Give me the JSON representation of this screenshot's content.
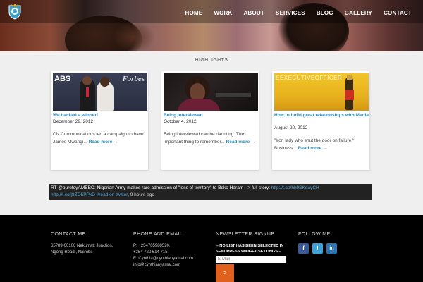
{
  "nav": {
    "items": [
      "HOME",
      "WORK",
      "ABOUT",
      "SERVICES",
      "BLOG",
      "GALLERY",
      "CONTACT"
    ]
  },
  "highlights": {
    "title": "HIGHLIGHTS",
    "cards": [
      {
        "title": "We backed a winner!",
        "date": "December 29, 2012",
        "excerpt": "  CN Communications led a campaign to have James Mwangi...",
        "more": "Read more →",
        "image_text_left": "ABS",
        "image_text_right": "Forbes"
      },
      {
        "title": "Being Interviewed",
        "date": "October 4, 2012",
        "excerpt": "Being interviewed can be daunting. The important thing to remember...",
        "more": "Read more →"
      },
      {
        "title": "How to build great relationships with Media",
        "date": "August 20, 2012",
        "excerpt": "\"Iron lady who shut the door on failure  \" Business...",
        "more": "Read more →",
        "image_text": "EEXECUTIVEOFFICER"
      }
    ]
  },
  "twitter": {
    "text": "RT @purefoyAMEBO: Nigerian Army makes rare admission of \"loss of territory\" to Boko Haram --> full story: ",
    "link1": "http://t.co/hh9SKdayCH",
    "link2": "http://t.co/j8ZO5PPxD",
    "link3": "#read on twitter",
    "time": ", 9 hours ago"
  },
  "footer": {
    "contact": {
      "heading": "CONTACT ME",
      "line1": "65789-00100 Nakumatt Junction,",
      "line2": "Ngong Road , Nairobi."
    },
    "phone": {
      "heading": "PHONE AND EMAIL",
      "line1": "P: +254705980520,",
      "line2": "+254 722 614 715",
      "line3": "E: Cynthia@cynthianyamai.com",
      "line4": "info@cynthianyamai.com"
    },
    "newsletter": {
      "heading": "NEWSLETTER SIGNUP",
      "warning": "-- NO LIST HAS BEEN SELECTED IN SENDPRESS WIDGET SETTINGS --",
      "email_placeholder": "E-Mail",
      "submit": ">"
    },
    "social": {
      "heading": "FOLLOW ME!",
      "icons": [
        "facebook-icon",
        "twitter-icon",
        "linkedin-icon"
      ],
      "facebook_glyph": "f",
      "twitter_glyph": "t",
      "linkedin_glyph": "in"
    }
  },
  "colors": {
    "accent_link": "#2d8dbf",
    "footer_bg": "#000000",
    "submit_bg": "#e0601d"
  }
}
